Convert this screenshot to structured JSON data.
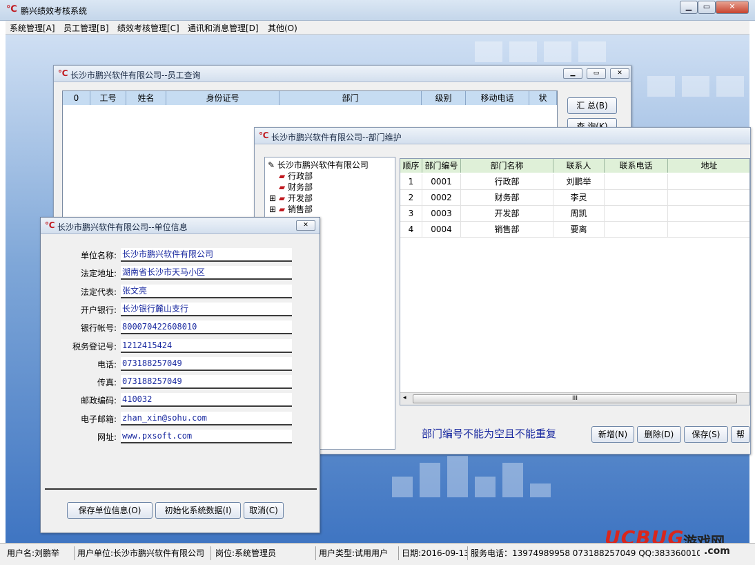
{
  "app": {
    "title": "鹏兴绩效考核系统",
    "logo": "℃"
  },
  "menu": [
    "系统管理[A]",
    "员工管理[B]",
    "绩效考核管理[C]",
    "通讯和消息管理[D]",
    "其他(O)"
  ],
  "emp_window": {
    "title": "长沙市鹏兴软件有限公司--员工查询",
    "columns": [
      "0",
      "工号",
      "姓名",
      "身份证号",
      "部门",
      "级别",
      "移动电话",
      "状"
    ],
    "buttons": [
      "汇 总(B)",
      "查 询(K)"
    ]
  },
  "dept_window": {
    "title": "长沙市鹏兴软件有限公司--部门维护",
    "tree": {
      "root": "长沙市鹏兴软件有限公司",
      "children": [
        {
          "label": "行政部",
          "expandable": false
        },
        {
          "label": "财务部",
          "expandable": false
        },
        {
          "label": "开发部",
          "expandable": true
        },
        {
          "label": "销售部",
          "expandable": true
        }
      ]
    },
    "columns": [
      "顺序",
      "部门编号",
      "部门名称",
      "联系人",
      "联系电话",
      "地址"
    ],
    "rows": [
      [
        "1",
        "0001",
        "行政部",
        "刘鹏举",
        "",
        ""
      ],
      [
        "2",
        "0002",
        "财务部",
        "李灵",
        "",
        ""
      ],
      [
        "3",
        "0003",
        "开发部",
        "周凯",
        "",
        ""
      ],
      [
        "4",
        "0004",
        "销售部",
        "要离",
        "",
        ""
      ]
    ],
    "scroll_grip": "III",
    "hint": "部门编号不能为空且不能重复",
    "buttons": [
      "新增(N)",
      "删除(D)",
      "保存(S)",
      "帮"
    ]
  },
  "unit_window": {
    "title": "长沙市鹏兴软件有限公司--单位信息",
    "fields": [
      {
        "label": "单位名称:",
        "value": "长沙市鹏兴软件有限公司"
      },
      {
        "label": "法定地址:",
        "value": "湖南省长沙市天马小区"
      },
      {
        "label": "法定代表:",
        "value": "张文亮"
      },
      {
        "label": "开户银行:",
        "value": "长沙银行麓山支行"
      },
      {
        "label": "银行帐号:",
        "value": "800070422608010"
      },
      {
        "label": "税务登记号:",
        "value": "1212415424"
      },
      {
        "label": "电话:",
        "value": "073188257049"
      },
      {
        "label": "传真:",
        "value": "073188257049"
      },
      {
        "label": "邮政编码:",
        "value": "410032"
      },
      {
        "label": "电子邮箱:",
        "value": "zhan_xin@sohu.com"
      },
      {
        "label": "网址:",
        "value": "www.pxsoft.com"
      }
    ],
    "buttons": [
      "保存单位信息(O)",
      "初始化系统数据(I)",
      "取消(C)"
    ]
  },
  "statusbar": [
    "用户名:刘鹏举",
    "用户单位:长沙市鹏兴软件有限公司",
    "岗位:系统管理员",
    "用户类型:试用用户",
    "日期:2016-09-13",
    "服务电话：13974989958  073188257049  QQ:383360010"
  ],
  "watermark": {
    "brand": "UCBUG",
    "cn": "游戏网",
    "suffix": ".com"
  },
  "colors": {
    "accent": "#c0191f",
    "link": "#1a2aa0"
  }
}
